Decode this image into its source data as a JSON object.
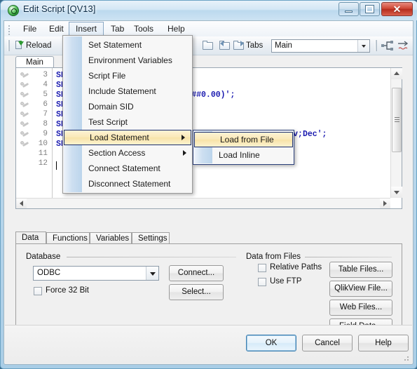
{
  "window": {
    "title": "Edit Script [QV13]",
    "icon": "qlikview-logo-icon",
    "minimize_label": "",
    "maximize_label": "",
    "close_label": "✕"
  },
  "menubar": {
    "items": [
      {
        "label": "File",
        "name": "menu-file"
      },
      {
        "label": "Edit",
        "name": "menu-edit"
      },
      {
        "label": "Insert",
        "name": "menu-insert"
      },
      {
        "label": "Tab",
        "name": "menu-tab"
      },
      {
        "label": "Tools",
        "name": "menu-tools"
      },
      {
        "label": "Help",
        "name": "menu-help"
      }
    ]
  },
  "toolbar": {
    "reload_label": "Reload",
    "tabs_label": "Tabs",
    "tabs_value": "Main",
    "icons": [
      "reload-icon",
      "debug-icon",
      "new-folder-icon",
      "back-icon",
      "forward-icon",
      "promote-tab-icon",
      "demote-tab-icon"
    ]
  },
  "insert_menu": {
    "items": [
      {
        "label": "Set Statement",
        "submenu": false,
        "selected": false
      },
      {
        "label": "Environment Variables",
        "submenu": false,
        "selected": false
      },
      {
        "label": "Script File",
        "submenu": false,
        "selected": false
      },
      {
        "label": "Include Statement",
        "submenu": false,
        "selected": false
      },
      {
        "label": "Domain SID",
        "submenu": false,
        "selected": false
      },
      {
        "label": "Test Script",
        "submenu": false,
        "selected": false
      },
      {
        "label": "Load Statement",
        "submenu": true,
        "selected": true
      },
      {
        "label": "Section Access",
        "submenu": true,
        "selected": false
      },
      {
        "label": "Connect Statement",
        "submenu": false,
        "selected": false
      },
      {
        "label": "Disconnect Statement",
        "submenu": false,
        "selected": false
      }
    ]
  },
  "load_submenu": {
    "items": [
      {
        "label": "Load from File",
        "selected": true
      },
      {
        "label": "Load Inline",
        "selected": false
      }
    ]
  },
  "script_tab": {
    "label": "Main"
  },
  "editor": {
    "line_numbers": [
      "3",
      "4",
      "5",
      "6",
      "7",
      "8",
      "9",
      "10",
      "11",
      "12"
    ],
    "lines": [
      {
        "num": "3",
        "text": "SE"
      },
      {
        "num": "4",
        "text": "SE"
      },
      {
        "num": "5",
        "text": "SE                       $#,##0.00)';"
      },
      {
        "num": "6",
        "text": "SE"
      },
      {
        "num": "7",
        "text": "SE"
      },
      {
        "num": "8",
        "text": "SE"
      },
      {
        "num": "9",
        "text": "SE                                      ep;Oct;Nov;Dec';"
      },
      {
        "num": "10",
        "text": "SE"
      },
      {
        "num": "11",
        "text": ""
      },
      {
        "num": "12",
        "text": ""
      }
    ]
  },
  "lower_tabs": [
    {
      "label": "Data",
      "active": true
    },
    {
      "label": "Functions",
      "active": false
    },
    {
      "label": "Variables",
      "active": false
    },
    {
      "label": "Settings",
      "active": false
    }
  ],
  "database_group": {
    "title": "Database",
    "driver_value": "ODBC",
    "connect_label": "Connect...",
    "select_label": "Select...",
    "force32_label": "Force 32 Bit",
    "force32_checked": false
  },
  "files_group": {
    "title": "Data from Files",
    "relative_paths_label": "Relative Paths",
    "relative_paths_checked": false,
    "use_ftp_label": "Use FTP",
    "use_ftp_checked": false,
    "buttons": [
      {
        "label": "Table Files..."
      },
      {
        "label": "QlikView File..."
      },
      {
        "label": "Web Files..."
      },
      {
        "label": "Field Data..."
      }
    ]
  },
  "dialog_buttons": {
    "ok": "OK",
    "cancel": "Cancel",
    "help": "Help"
  },
  "colors": {
    "accent": "#3c7fb1",
    "menu_highlight": "#fae9b6",
    "menu_highlight_border": "#1b2f6e",
    "script_keyword": "#1b1bb0",
    "close_button": "#cf4836"
  }
}
